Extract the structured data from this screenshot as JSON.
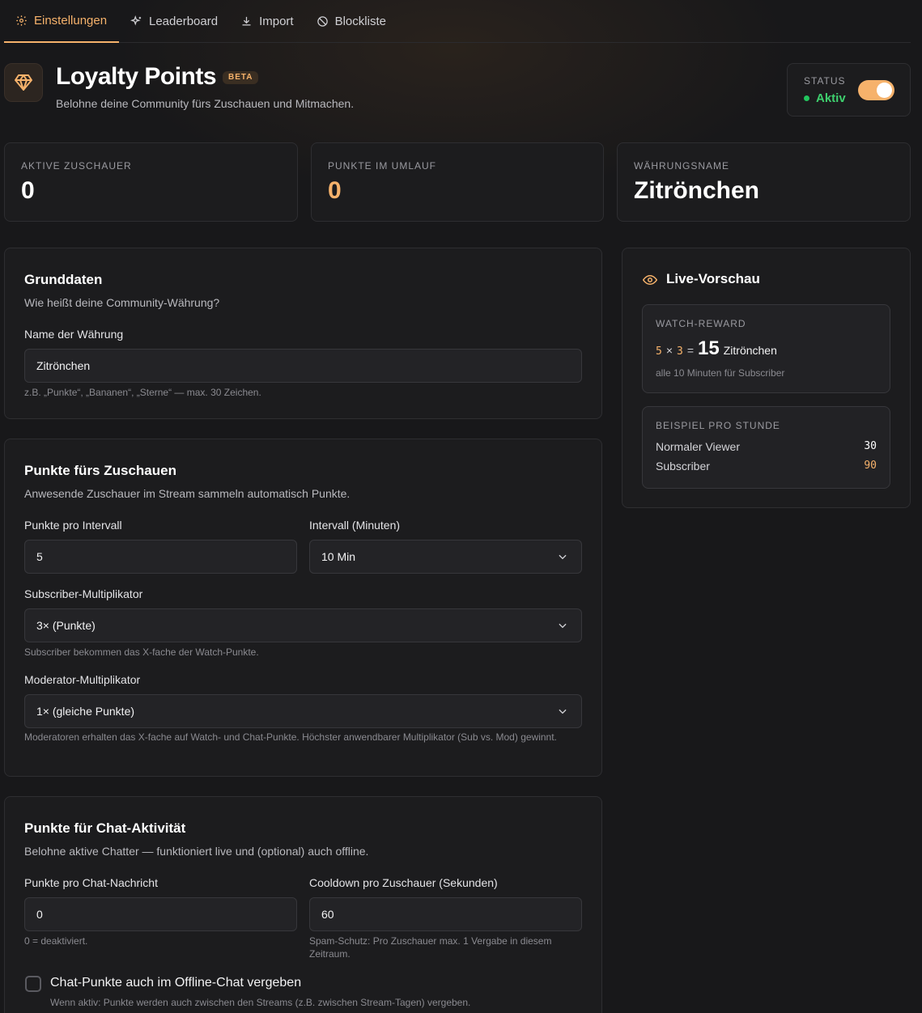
{
  "tabs": [
    {
      "label": "Einstellungen",
      "icon": "gear-icon",
      "active": true
    },
    {
      "label": "Leaderboard",
      "icon": "sparkles-icon",
      "active": false
    },
    {
      "label": "Import",
      "icon": "download-icon",
      "active": false
    },
    {
      "label": "Blockliste",
      "icon": "ban-icon",
      "active": false
    }
  ],
  "header": {
    "title": "Loyalty Points",
    "badge": "BETA",
    "subtitle": "Belohne deine Community fürs Zuschauen und Mitmachen.",
    "status_label": "STATUS",
    "status_value": "Aktiv",
    "status_on": true
  },
  "stats": [
    {
      "label": "AKTIVE ZUSCHAUER",
      "value": "0"
    },
    {
      "label": "PUNKTE IM UMLAUF",
      "value": "0"
    },
    {
      "label": "WÄHRUNGSNAME",
      "value": "Zitrönchen"
    }
  ],
  "grunddaten": {
    "title": "Grunddaten",
    "desc": "Wie heißt deine Community-Währung?",
    "name_label": "Name der Währung",
    "name_value": "Zitrönchen",
    "name_hint": "z.B. „Punkte“, „Bananen“, „Sterne“ — max. 30 Zeichen."
  },
  "watch": {
    "title": "Punkte fürs Zuschauen",
    "desc": "Anwesende Zuschauer im Stream sammeln automatisch Punkte.",
    "points_label": "Punkte pro Intervall",
    "points_value": "5",
    "interval_label": "Intervall (Minuten)",
    "interval_value": "10 Min",
    "sub_label": "Subscriber-Multiplikator",
    "sub_value": "3× (Punkte)",
    "sub_hint": "Subscriber bekommen das X-fache der Watch-Punkte.",
    "mod_label": "Moderator-Multiplikator",
    "mod_value": "1× (gleiche Punkte)",
    "mod_hint": "Moderatoren erhalten das X-fache auf Watch- und Chat-Punkte. Höchster anwendbarer Multiplikator (Sub vs. Mod) gewinnt."
  },
  "chat": {
    "title": "Punkte für Chat-Aktivität",
    "desc": "Belohne aktive Chatter — funktioniert live und (optional) auch offline.",
    "points_label": "Punkte pro Chat-Nachricht",
    "points_value": "0",
    "points_hint": "0 = deaktiviert.",
    "cooldown_label": "Cooldown pro Zuschauer (Sekunden)",
    "cooldown_value": "60",
    "cooldown_hint": "Spam-Schutz: Pro Zuschauer max. 1 Vergabe in diesem Zeitraum.",
    "offline_label": "Chat-Punkte auch im Offline-Chat vergeben",
    "offline_hint": "Wenn aktiv: Punkte werden auch zwischen den Streams (z.B. zwischen Stream-Tagen) vergeben.",
    "offline_checked": false
  },
  "preview": {
    "title": "Live-Vorschau",
    "reward_label": "WATCH-REWARD",
    "base": "5",
    "times": "×",
    "mult": "3",
    "equals": "=",
    "result": "15",
    "currency": "Zitrönchen",
    "reward_hint": "alle 10 Minuten für Subscriber",
    "hour_label": "BEISPIEL PRO STUNDE",
    "rows": [
      {
        "label": "Normaler Viewer",
        "value": "30"
      },
      {
        "label": "Subscriber",
        "value": "90"
      }
    ]
  },
  "colors": {
    "accent": "#f6b26b",
    "active": "#22c55e",
    "background": "#18181a"
  }
}
